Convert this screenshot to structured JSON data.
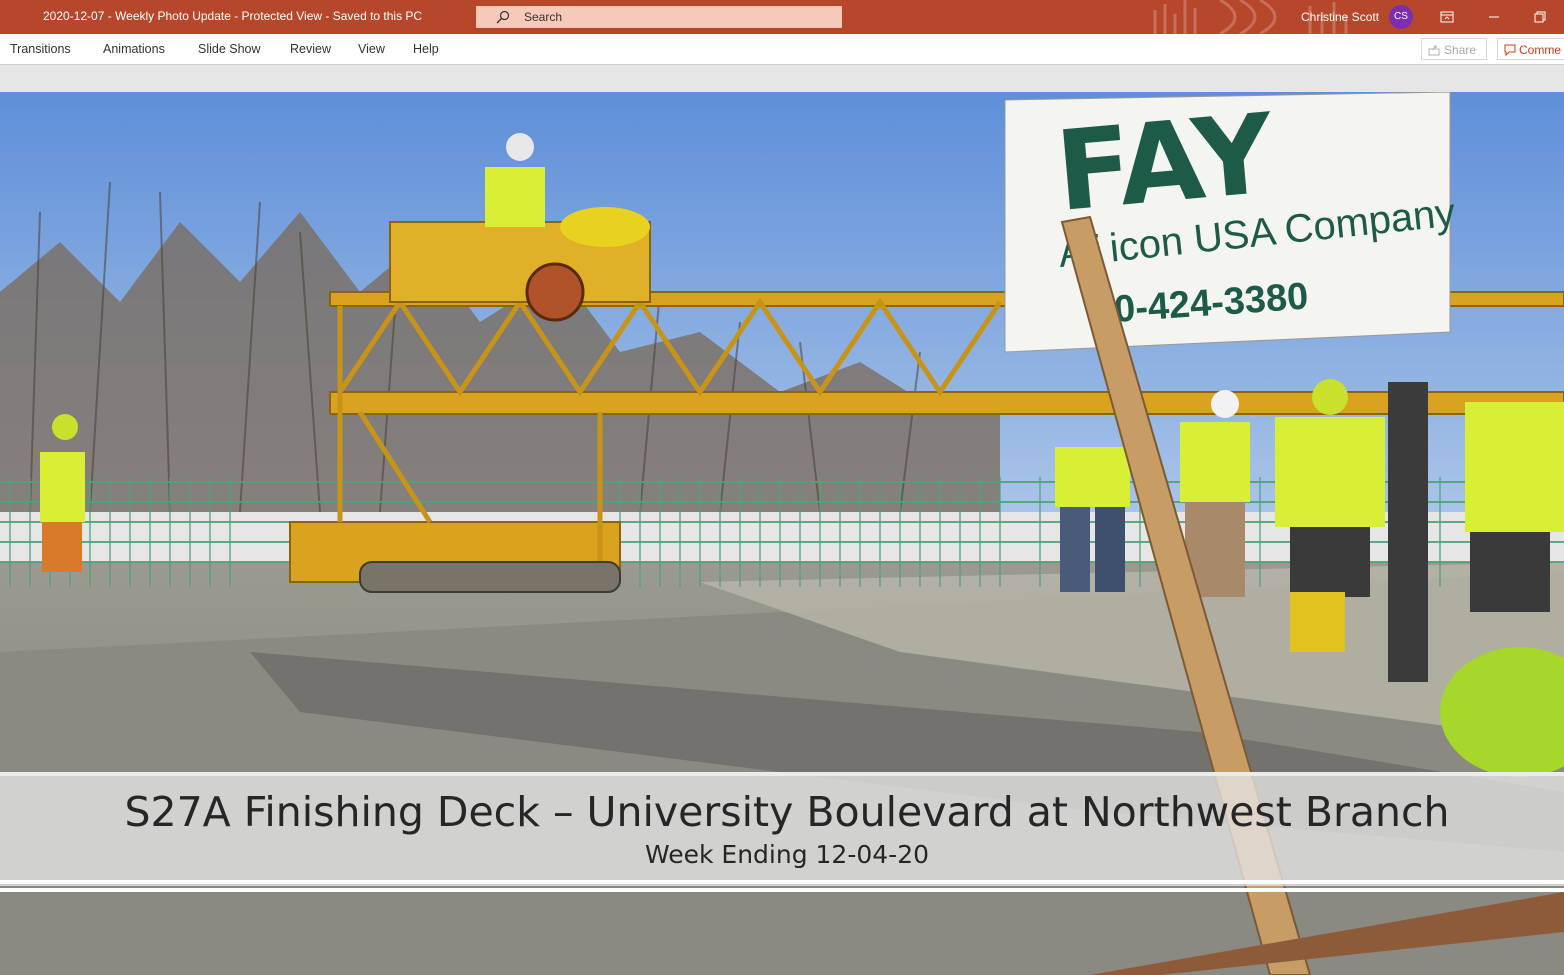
{
  "titlebar": {
    "document_title": "2020-12-07 - Weekly Photo Update  -  Protected View  -  Saved to this PC",
    "search_placeholder": "Search",
    "user_name": "Christine Scott",
    "user_initials": "CS",
    "accent_color": "#b7472a",
    "avatar_color": "#7b2fb0"
  },
  "ribbon": {
    "tabs": [
      "Transitions",
      "Animations",
      "Slide Show",
      "Review",
      "View",
      "Help"
    ],
    "share_label": "Share",
    "comments_label": "Comme"
  },
  "slide": {
    "title": "S27A Finishing Deck – University Boulevard at Northwest Branch",
    "subtitle": "Week Ending 12-04-20",
    "photo_signage": {
      "brand": "FAY",
      "company_line": "A i icon USA Company",
      "phone": "0-424-3380"
    }
  }
}
